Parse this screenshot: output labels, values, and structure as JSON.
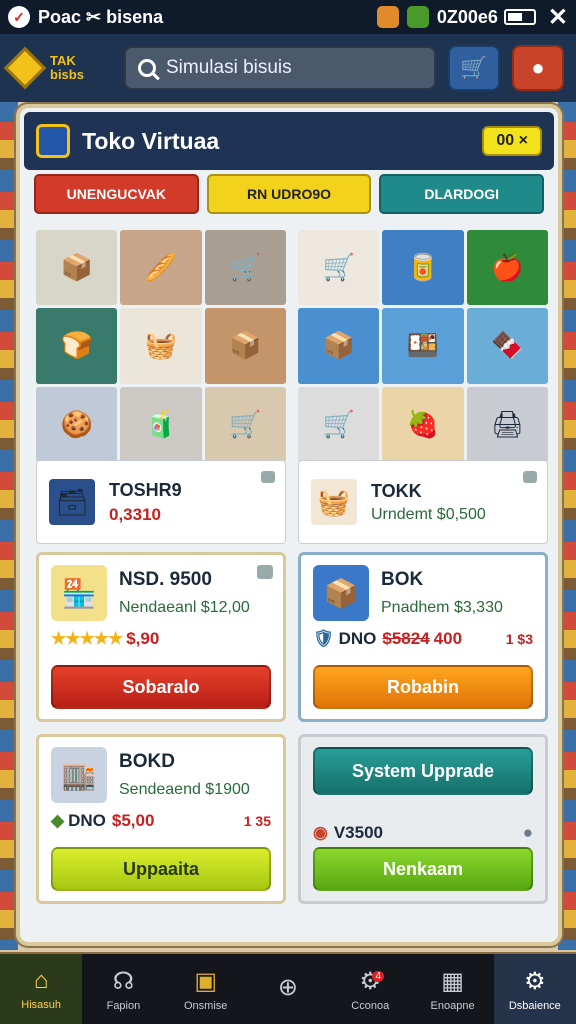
{
  "status": {
    "left_text": "Poac ✂ bisena",
    "time": "0Z00e6",
    "close_glyph": "✕"
  },
  "topbar": {
    "logo_text_1": "TAK",
    "logo_text_2": "bisbs",
    "search_text": "Simulasi bisuis"
  },
  "panel": {
    "title": "Toko Virtuaa",
    "close_label": "00 ×",
    "tabs": [
      "UNENGUCVAK",
      "RN UDRO9O",
      "DLARDOGI"
    ]
  },
  "info_left": {
    "name": "TOSHR9",
    "value": "0,3310"
  },
  "info_right": {
    "name": "TOKK",
    "detail": "Urndemt $0,500"
  },
  "cards": [
    {
      "name": "NSD. 9500",
      "sub": "Nendaeanl $12,00",
      "price": "$,90",
      "button": "Sobaralo",
      "stars": "★★★★★"
    },
    {
      "name": "BOK",
      "sub": "Pnadhem $3,330",
      "code": "DNO",
      "old_price": "$5824",
      "new_price": "400",
      "extra": "1 $3",
      "button": "Robabin"
    },
    {
      "name": "BOKD",
      "sub": "Sendeaend $1900",
      "price_left": "DNO",
      "price": "$5,00",
      "extra": "1 35",
      "button": "Uppaaita"
    },
    {
      "button_top": "System Upprade",
      "price": "V3500",
      "button": "Nenkaam"
    }
  ],
  "nav": [
    {
      "label": "Hisasuh",
      "icon": "⌂"
    },
    {
      "label": "Fapion",
      "icon": "☊"
    },
    {
      "label": "Onsmise",
      "icon": "▣"
    },
    {
      "label": "",
      "icon": "⊕"
    },
    {
      "label": "Cconoa",
      "icon": "⚙",
      "badge": "4"
    },
    {
      "label": "Enoapne",
      "icon": "▦"
    },
    {
      "label": "Dsbaience",
      "icon": "⚙"
    }
  ]
}
